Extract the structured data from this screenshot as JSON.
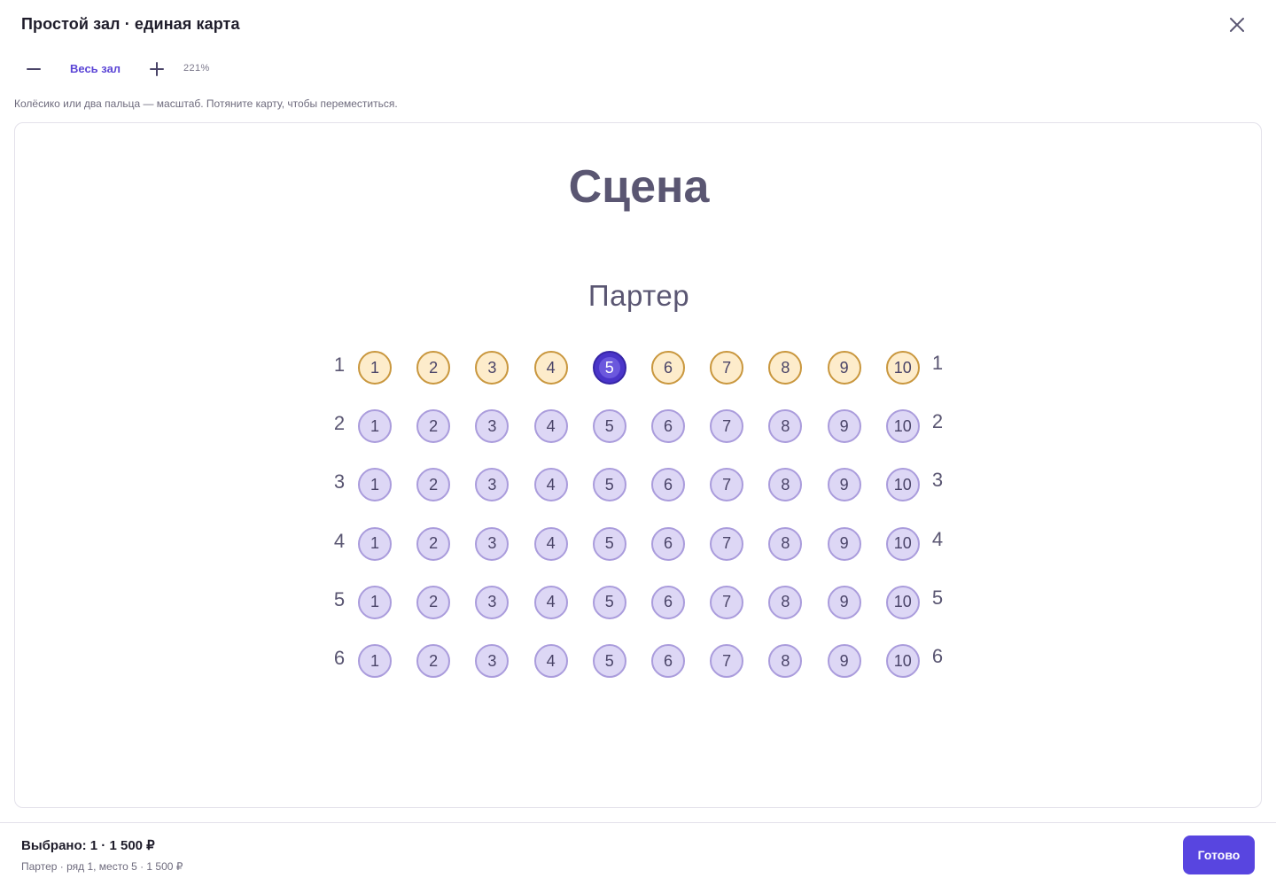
{
  "header": {
    "title": "Простой зал · единая карта"
  },
  "toolbar": {
    "fit_label": "Весь зал",
    "zoom_level": "221%"
  },
  "hint": "Колёсико или два пальца — масштаб. Потяните карту, чтобы переместиться.",
  "map": {
    "stage_label": "Сцена",
    "section_label": "Партер",
    "rows": [
      {
        "label": "1",
        "seats": [
          {
            "n": "1",
            "state": "vip"
          },
          {
            "n": "2",
            "state": "vip"
          },
          {
            "n": "3",
            "state": "vip"
          },
          {
            "n": "4",
            "state": "vip"
          },
          {
            "n": "5",
            "state": "selected"
          },
          {
            "n": "6",
            "state": "vip"
          },
          {
            "n": "7",
            "state": "vip"
          },
          {
            "n": "8",
            "state": "vip"
          },
          {
            "n": "9",
            "state": "vip"
          },
          {
            "n": "10",
            "state": "vip"
          }
        ]
      },
      {
        "label": "2",
        "seats": [
          {
            "n": "1",
            "state": "free"
          },
          {
            "n": "2",
            "state": "free"
          },
          {
            "n": "3",
            "state": "free"
          },
          {
            "n": "4",
            "state": "free"
          },
          {
            "n": "5",
            "state": "free"
          },
          {
            "n": "6",
            "state": "free"
          },
          {
            "n": "7",
            "state": "free"
          },
          {
            "n": "8",
            "state": "free"
          },
          {
            "n": "9",
            "state": "free"
          },
          {
            "n": "10",
            "state": "free"
          }
        ]
      },
      {
        "label": "3",
        "seats": [
          {
            "n": "1",
            "state": "free"
          },
          {
            "n": "2",
            "state": "free"
          },
          {
            "n": "3",
            "state": "free"
          },
          {
            "n": "4",
            "state": "free"
          },
          {
            "n": "5",
            "state": "free"
          },
          {
            "n": "6",
            "state": "free"
          },
          {
            "n": "7",
            "state": "free"
          },
          {
            "n": "8",
            "state": "free"
          },
          {
            "n": "9",
            "state": "free"
          },
          {
            "n": "10",
            "state": "free"
          }
        ]
      },
      {
        "label": "4",
        "seats": [
          {
            "n": "1",
            "state": "free"
          },
          {
            "n": "2",
            "state": "free"
          },
          {
            "n": "3",
            "state": "free"
          },
          {
            "n": "4",
            "state": "free"
          },
          {
            "n": "5",
            "state": "free"
          },
          {
            "n": "6",
            "state": "free"
          },
          {
            "n": "7",
            "state": "free"
          },
          {
            "n": "8",
            "state": "free"
          },
          {
            "n": "9",
            "state": "free"
          },
          {
            "n": "10",
            "state": "free"
          }
        ]
      },
      {
        "label": "5",
        "seats": [
          {
            "n": "1",
            "state": "free"
          },
          {
            "n": "2",
            "state": "free"
          },
          {
            "n": "3",
            "state": "free"
          },
          {
            "n": "4",
            "state": "free"
          },
          {
            "n": "5",
            "state": "free"
          },
          {
            "n": "6",
            "state": "free"
          },
          {
            "n": "7",
            "state": "free"
          },
          {
            "n": "8",
            "state": "free"
          },
          {
            "n": "9",
            "state": "free"
          },
          {
            "n": "10",
            "state": "free"
          }
        ]
      },
      {
        "label": "6",
        "seats": [
          {
            "n": "1",
            "state": "free"
          },
          {
            "n": "2",
            "state": "free"
          },
          {
            "n": "3",
            "state": "free"
          },
          {
            "n": "4",
            "state": "free"
          },
          {
            "n": "5",
            "state": "free"
          },
          {
            "n": "6",
            "state": "free"
          },
          {
            "n": "7",
            "state": "free"
          },
          {
            "n": "8",
            "state": "free"
          },
          {
            "n": "9",
            "state": "free"
          },
          {
            "n": "10",
            "state": "free"
          }
        ]
      }
    ]
  },
  "footer": {
    "summary": "Выбрано: 1 · 1 500 ₽",
    "details": "Партер · ряд 1, место 5 · 1 500 ₽",
    "done_label": "Готово"
  },
  "colors": {
    "accent": "#5845e0",
    "seat_free": "#ddd7f5",
    "seat_vip": "#fdeccb",
    "seat_selected": "#4a35c9"
  },
  "icons": {
    "close": "close-icon",
    "zoom_out": "minus-icon",
    "zoom_in": "plus-icon"
  }
}
